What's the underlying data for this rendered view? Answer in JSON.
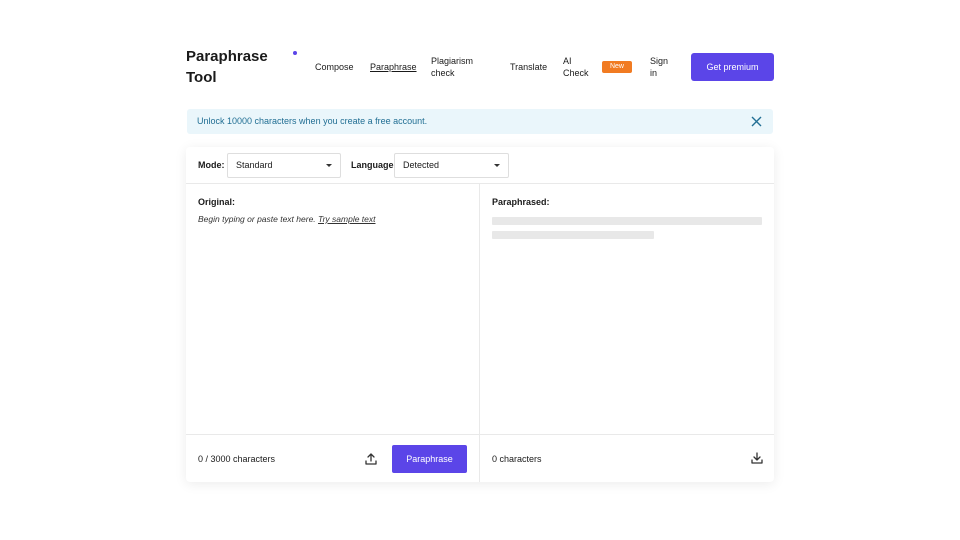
{
  "header": {
    "logo": "Paraphrase Tool",
    "nav": [
      {
        "label": "Compose",
        "active": false
      },
      {
        "label": "Paraphrase",
        "active": true
      },
      {
        "label": "Plagiarism check",
        "active": false
      },
      {
        "label": "Translate",
        "active": false
      },
      {
        "label": "AI Check",
        "active": false
      },
      {
        "label": "Sign in",
        "active": false
      }
    ],
    "badge": "New",
    "premium_label": "Get premium"
  },
  "banner": {
    "text": "Unlock 10000 characters when you create a free account."
  },
  "toolbar": {
    "mode_label": "Mode:",
    "mode_value": "Standard",
    "language_label": "Language:",
    "language_value": "Detected"
  },
  "original": {
    "label": "Original:",
    "placeholder": "Begin typing or paste text here.",
    "sample_link": "Try sample text",
    "count": "0 / 3000 characters",
    "action_label": "Paraphrase"
  },
  "paraphrased": {
    "label": "Paraphrased:",
    "count": "0 characters"
  },
  "colors": {
    "accent": "#5b45e8",
    "badge": "#f17b22",
    "banner_bg": "#eaf6fb",
    "banner_text": "#226f94"
  },
  "icons": {
    "logo_dot": "dot-icon",
    "banner_close": "close-icon",
    "upload": "upload-icon",
    "download": "download-icon",
    "select_caret": "caret-down-icon"
  }
}
